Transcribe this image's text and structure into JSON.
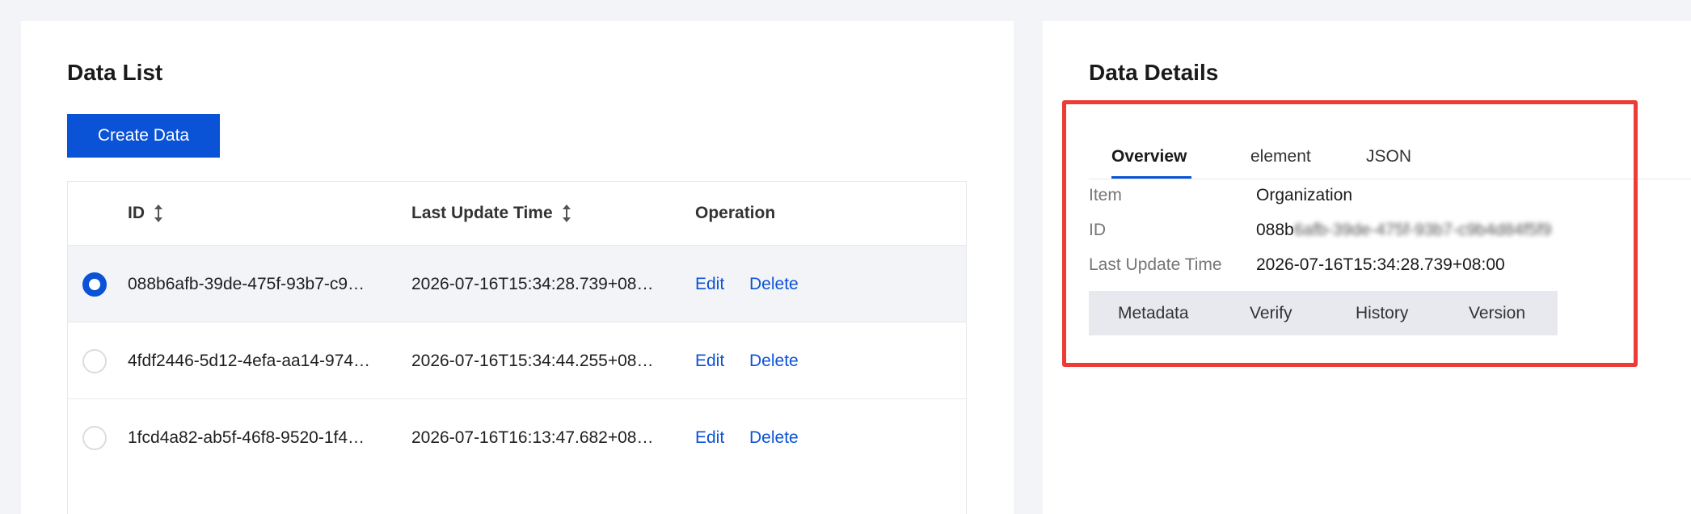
{
  "left": {
    "title": "Data List",
    "create_button": "Create Data",
    "columns": {
      "id": "ID",
      "updated": "Last Update Time",
      "operation": "Operation"
    },
    "rows": [
      {
        "id": "088b6afb-39de-475f-93b7-c9…",
        "updated": "2026-07-16T15:34:28.739+08…",
        "edit": "Edit",
        "delete": "Delete",
        "selected": true
      },
      {
        "id": "4fdf2446-5d12-4efa-aa14-974…",
        "updated": "2026-07-16T15:34:44.255+08…",
        "edit": "Edit",
        "delete": "Delete",
        "selected": false
      },
      {
        "id": "1fcd4a82-ab5f-46f8-9520-1f4…",
        "updated": "2026-07-16T16:13:47.682+08…",
        "edit": "Edit",
        "delete": "Delete",
        "selected": false
      }
    ]
  },
  "right": {
    "title": "Data Details",
    "tabs": [
      "Overview",
      "element",
      "JSON"
    ],
    "active_tab": "Overview",
    "fields": {
      "item_label": "Item",
      "item_value": "Organization",
      "id_label": "ID",
      "id_value_visible": "088b",
      "id_value_blurred": "6afb-39de-475f-93b7-c9b4d84f5f9",
      "updated_label": "Last Update Time",
      "updated_value": "2026-07-16T15:34:28.739+08:00"
    },
    "actions": [
      "Metadata",
      "Verify",
      "History",
      "Version"
    ]
  },
  "colors": {
    "accent": "#0a52d6",
    "highlight": "#ee3b36",
    "background": "#f3f4f7"
  }
}
